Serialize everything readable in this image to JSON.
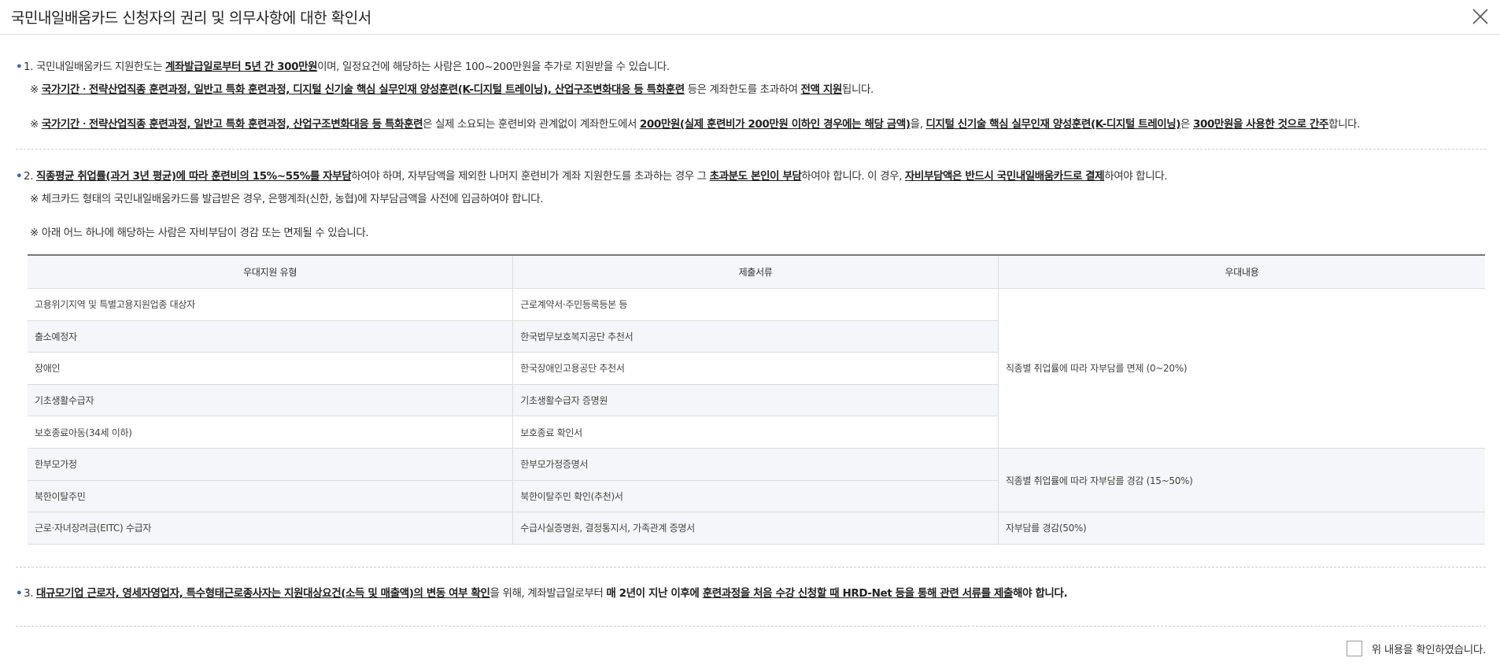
{
  "header": {
    "title": "국민내일배움카드 신청자의 권리 및 의무사항에 대한 확인서",
    "close_icon": "close-icon"
  },
  "section1": {
    "bullet": "•",
    "line1": {
      "a": "1. 국민내일배움카드 지원한도는 ",
      "b": "계좌발급일로부터 5년 간 300만원",
      "c": "이며, 일정요건에 해당하는 사람은 100~200만원을 추가로 지원받을 수 있습니다."
    },
    "note1": {
      "a": "※ ",
      "b": "국가기간ㆍ전략산업직종 훈련과정, 일반고 특화 훈련과정, 디지털 신기술 핵심 실무인재 양성훈련(K-디지털 트레이닝), 산업구조변화대응 등 특화훈련",
      "c": " 등은 계좌한도를 초과하여 ",
      "d": "전액 지원",
      "e": "됩니다."
    },
    "note2": {
      "a": "※ ",
      "b": "국가기간ㆍ전략산업직종 훈련과정, 일반고 특화 훈련과정, 산업구조변화대응 등 특화훈련",
      "c": "은 실제 소요되는 훈련비와 관계없이 계좌한도에서 ",
      "d": "200만원(실제 훈련비가 200만원 이하인 경우에는 해당 금액)",
      "e": "을, ",
      "f": "디지털 신기술 핵심 실무인재 양성훈련(K-디지털 트레이닝)",
      "g": "은 ",
      "h": "300만원을 사용한 것으로 간주",
      "i": "합니다."
    }
  },
  "section2": {
    "bullet": "•",
    "line1": {
      "a": "2. ",
      "b": "직종평균 취업률(과거 3년 평균)에 따라 훈련비의 15%~55%를 자부담",
      "c": "하여야 하며, 자부담액을 제외한 나머지 훈련비가 계좌 지원한도를 초과하는 경우 그 ",
      "d": "초과분도 본인이 부담",
      "e": "하여야 합니다. 이 경우, ",
      "f": "자비부담액은 반드시 국민내일배움카드로 결제",
      "g": "하여야 합니다."
    },
    "note1": "※ 체크카드 형태의 국민내일배움카드를 발급받은 경우, 은행계좌(신한, 농협)에 자부담금액을 사전에 입금하여야 합니다.",
    "note2": "※ 아래 어느 하나에 해당하는 사람은 자비부담이 경감 또는 면제될 수 있습니다.",
    "table": {
      "headers": [
        "우대지원 유형",
        "제출서류",
        "우대내용"
      ],
      "rows": [
        {
          "type": "고용위기지역 및 특별고용지원업종 대상자",
          "doc": "근로계약서·주민등록등본 등"
        },
        {
          "type": "출소예정자",
          "doc": "한국법무보호복지공단 추천서"
        },
        {
          "type": "장애인",
          "doc": "한국장애인고용공단 추천서"
        },
        {
          "type": "기초생활수급자",
          "doc": "기초생활수급자 증명원"
        },
        {
          "type": "보호종료아동(34세 이하)",
          "doc": "보호종료 확인서"
        },
        {
          "type": "한부모가정",
          "doc": "한부모가정증명서"
        },
        {
          "type": "북한이탈주민",
          "doc": "북한이탈주민 확인(추천)서"
        },
        {
          "type": "근로·자녀장려금(EITC) 수급자",
          "doc": "수급사실증명원, 결정통지서, 가족관계 증명서"
        }
      ],
      "benefits": [
        "직종별 취업률에 따라 자부담를 면제 (0~20%)",
        "직종별 취업률에 따라 자부담를 경감 (15~50%)",
        "자부담를 경감(50%)"
      ]
    }
  },
  "section3": {
    "bullet": "•",
    "line1": {
      "a": "3. ",
      "b": "대규모기업 근로자, 영세자영업자, 특수형태근로종사자는 지원대상요건(소득 및 매출액)의 변동 여부 확인",
      "c": "을 위해, 계좌발급일로부터 ",
      "d": "매 2년이 지난 이후에 ",
      "e": "훈련과정을 처음 수강 신청할 때 HRD-Net 등을 통해 관련 서류를 제출",
      "f": "해야 합니다."
    }
  },
  "confirm": {
    "label": "위 내용을 확인하였습니다."
  }
}
